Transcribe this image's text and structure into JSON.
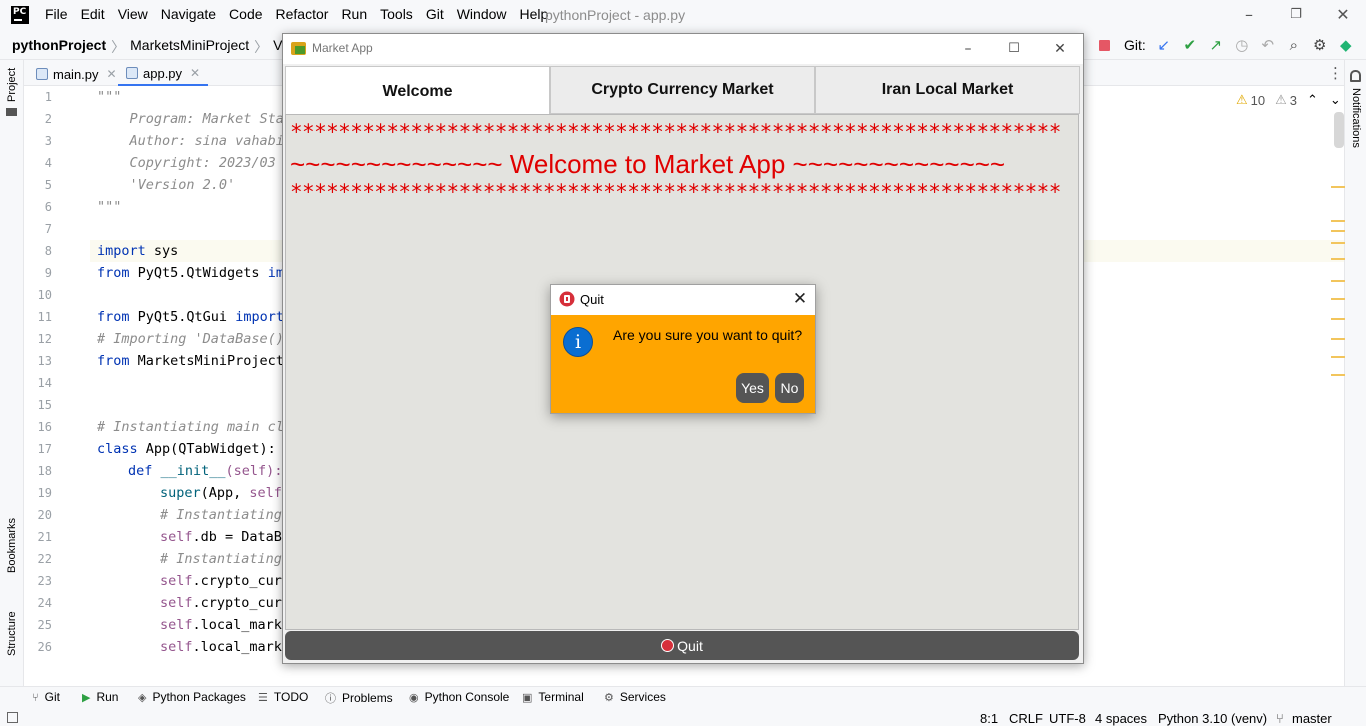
{
  "ide": {
    "menu": [
      "File",
      "Edit",
      "View",
      "Navigate",
      "Code",
      "Refactor",
      "Run",
      "Tools",
      "Git",
      "Window",
      "Help"
    ],
    "title": "pythonProject - app.py",
    "breadcrumb": {
      "root": "pythonProject",
      "items": [
        "MarketsMiniProject",
        "Version"
      ]
    },
    "git_label": "Git:",
    "editor_tabs": [
      {
        "label": "main.py",
        "active": false
      },
      {
        "label": "app.py",
        "active": true
      }
    ],
    "left_tools": [
      "Project",
      "Bookmarks",
      "Structure"
    ],
    "right_tools": [
      "Notifications"
    ],
    "warnings": {
      "warn_count": "10",
      "weak_count": "3"
    },
    "line_numbers": [
      "1",
      "2",
      "3",
      "4",
      "5",
      "6",
      "7",
      "8",
      "9",
      "10",
      "11",
      "12",
      "13",
      "14",
      "15",
      "16",
      "17",
      "18",
      "19",
      "20",
      "21",
      "22",
      "23",
      "24",
      "25",
      "26"
    ],
    "code": {
      "l1": "\"\"\"",
      "l2": "    Program: Market Sta",
      "l3": "    Author: sina vahabi",
      "l4": "    Copyright: 2023/03",
      "l5": "    'Version 2.0'",
      "l6": "\"\"\"",
      "l8a": "import",
      "l8b": " sys",
      "l9a": "from",
      "l9b": " PyQt5.QtWidgets ",
      "l9c": "imp",
      "l11a": "from",
      "l11b": " PyQt5.QtGui ",
      "l11c": "import",
      "l12": "# Importing 'DataBase()",
      "l13a": "from",
      "l13b": " MarketsMiniProject",
      "l16": "# Instantiating main cl",
      "l17a": "class",
      "l17b": " App(QTabWidget):",
      "l18a": "def",
      "l18b": " __init__",
      "l18c": "(self):",
      "l19a": "super",
      "l19b": "(App, ",
      "l19c": "self",
      "l20": "# Instantiating",
      "l21a": "self",
      "l21b": ".db = DataBa",
      "l22": "# Instantiating",
      "l23a": "self",
      "l23b": ".crypto_curr",
      "l24a": "self",
      "l24b": ".crypto_curr",
      "l25a": "self",
      "l25b": ".local_marke",
      "l26a": "self",
      "l26b": ".local_marke"
    },
    "tool_windows": [
      "Git",
      "Run",
      "Python Packages",
      "TODO",
      "Problems",
      "Python Console",
      "Terminal",
      "Services"
    ],
    "status": {
      "position": "8:1",
      "line_sep": "CRLF",
      "encoding": "UTF-8",
      "indent": "4 spaces",
      "interpreter": "Python 3.10 (venv)",
      "branch": "master"
    }
  },
  "market_app": {
    "title": "Market App",
    "tabs": [
      "Welcome",
      "Crypto Currency Market",
      "Iran Local Market"
    ],
    "stars_line": "****************************************************************",
    "welcome_text": "~~~~~~~~~~~~~~ Welcome to Market App ~~~~~~~~~~~~~~",
    "quit_label": "Quit",
    "colors": {
      "accent_text": "#e00000",
      "button_bg": "#555555",
      "panel_bg": "#e3e3df"
    }
  },
  "dialog": {
    "title": "Quit",
    "message": "Are you sure you want to quit?",
    "yes": "Yes",
    "no": "No",
    "icon": "info-icon",
    "colors": {
      "background": "#ffa500",
      "info": "#0a6ed1"
    }
  }
}
